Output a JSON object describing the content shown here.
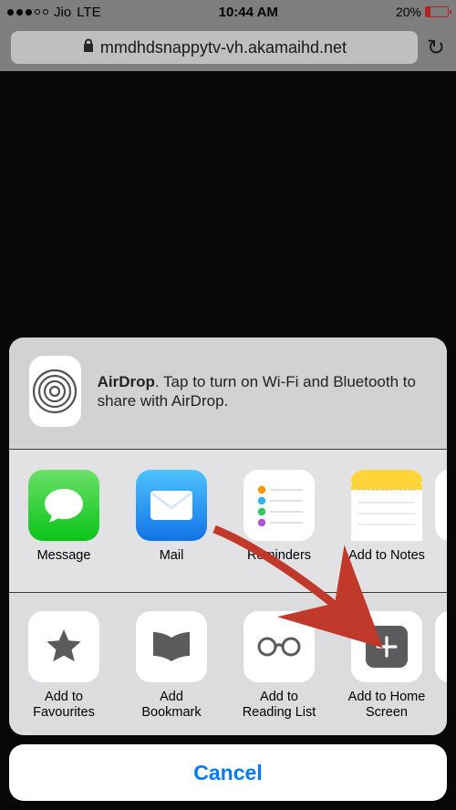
{
  "status": {
    "carrier": "Jio",
    "network": "LTE",
    "time": "10:44 AM",
    "battery_pct": "20%"
  },
  "browser": {
    "url": "mmdhdsnappytv-vh.akamaihd.net"
  },
  "share": {
    "airdrop_bold": "AirDrop",
    "airdrop_rest": ". Tap to turn on Wi-Fi and Bluetooth to share with AirDrop.",
    "apps": [
      {
        "label": "Message"
      },
      {
        "label": "Mail"
      },
      {
        "label": "Reminders"
      },
      {
        "label": "Add to Notes"
      }
    ],
    "actions": [
      {
        "label": "Add to Favourites"
      },
      {
        "label": "Add Bookmark"
      },
      {
        "label": "Add to Reading List"
      },
      {
        "label": "Add to Home Screen"
      }
    ],
    "cancel": "Cancel"
  }
}
